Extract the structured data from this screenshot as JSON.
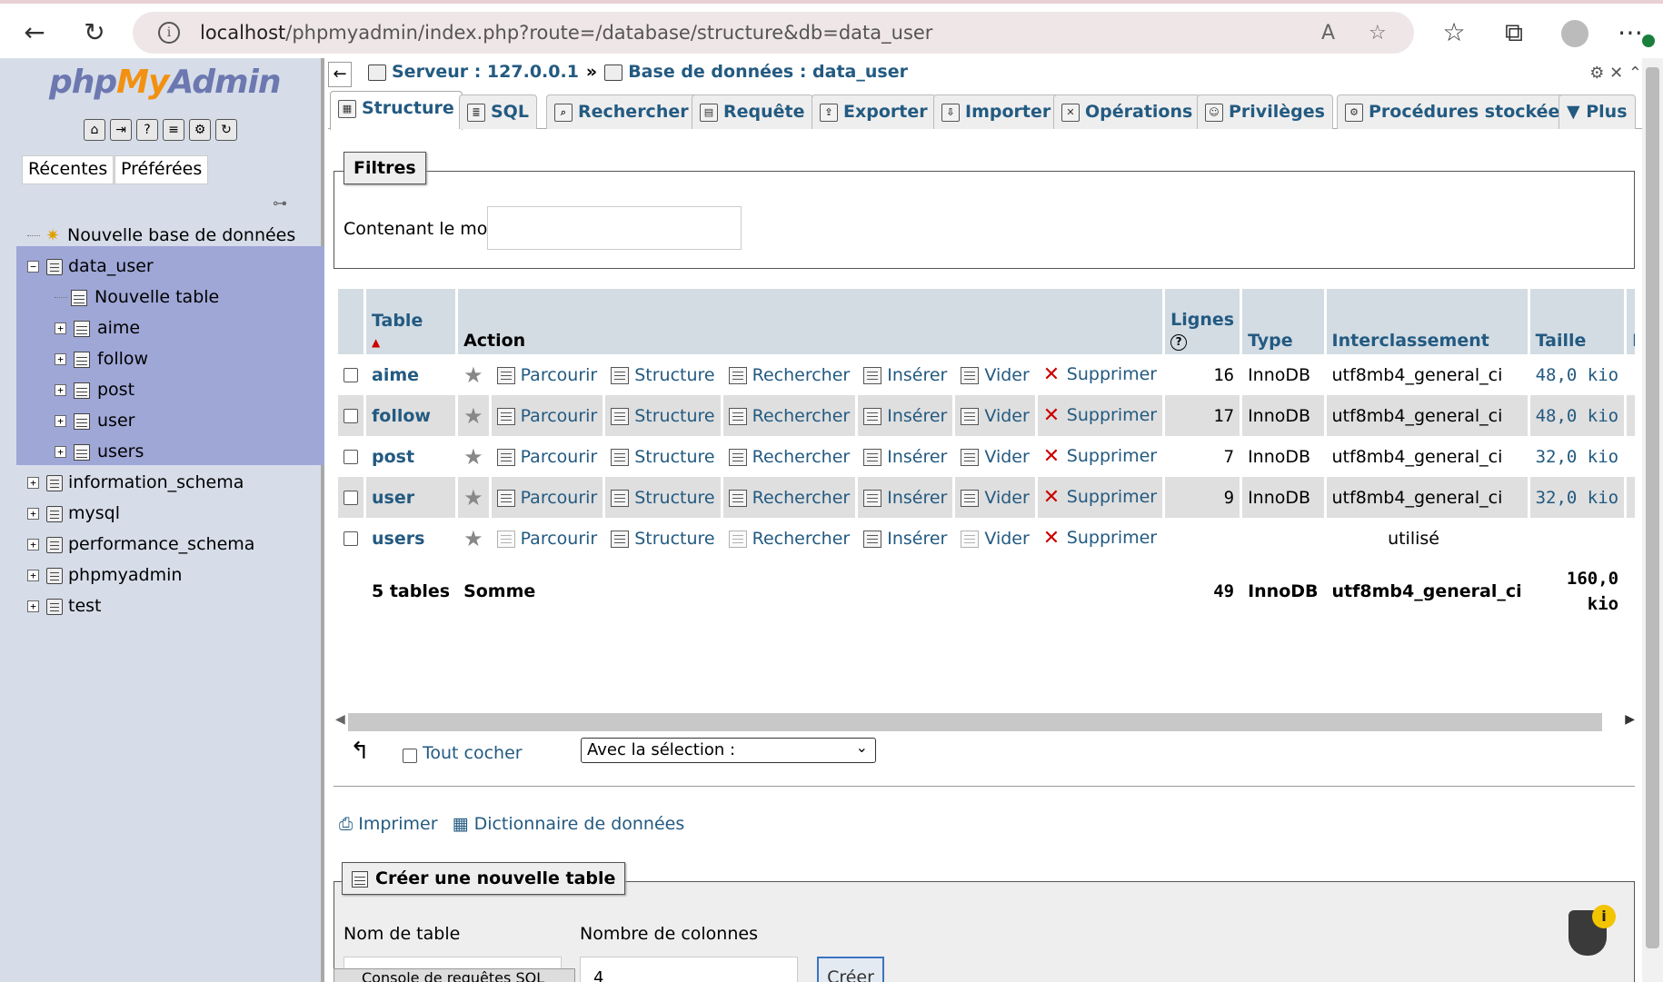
{
  "browser": {
    "url_host": "localhost",
    "url_path": "/phpmyadmin/index.php?route=/database/structure&db=data_user"
  },
  "left": {
    "logo_php": "php",
    "logo_my": "My",
    "logo_admin": "Admin",
    "tab_recent": "Récentes",
    "tab_fav": "Préférées",
    "new_db": "Nouvelle base de données",
    "db_active": "data_user",
    "new_table": "Nouvelle table",
    "active_tables": [
      "aime",
      "follow",
      "post",
      "user",
      "users"
    ],
    "other_dbs": [
      "information_schema",
      "mysql",
      "performance_schema",
      "phpmyadmin",
      "test"
    ]
  },
  "crumb": {
    "server": "Serveur : 127.0.0.1",
    "sep": "»",
    "db": "Base de données : data_user"
  },
  "tabs": [
    "Structure",
    "SQL",
    "Rechercher",
    "Requête",
    "Exporter",
    "Importer",
    "Opérations",
    "Privilèges",
    "Procédures stockées",
    "Plus"
  ],
  "filters": {
    "legend": "Filtres",
    "label": "Contenant le mot :"
  },
  "table": {
    "headers": {
      "table": "Table",
      "action": "Action",
      "rows": "Lignes",
      "type": "Type",
      "collation": "Interclassement",
      "size": "Taille",
      "overhead": "Pe"
    },
    "actions": [
      "Parcourir",
      "Structure",
      "Rechercher",
      "Insérer",
      "Vider",
      "Supprimer"
    ],
    "rows": [
      {
        "name": "aime",
        "rows": "16",
        "type": "InnoDB",
        "collation": "utf8mb4_general_ci",
        "size": "48,0 kio"
      },
      {
        "name": "follow",
        "rows": "17",
        "type": "InnoDB",
        "collation": "utf8mb4_general_ci",
        "size": "48,0 kio"
      },
      {
        "name": "post",
        "rows": "7",
        "type": "InnoDB",
        "collation": "utf8mb4_general_ci",
        "size": "32,0 kio"
      },
      {
        "name": "user",
        "rows": "9",
        "type": "InnoDB",
        "collation": "utf8mb4_general_ci",
        "size": "32,0 kio"
      },
      {
        "name": "users",
        "in_use": "utilisé"
      }
    ],
    "sum": {
      "label": "5 tables",
      "action": "Somme",
      "rows": "49",
      "type": "InnoDB",
      "collation": "utf8mb4_general_ci",
      "size_1": "160,0",
      "size_2": "kio",
      "overhead": "("
    }
  },
  "bulk": {
    "check_all": "Tout cocher",
    "with_selection": "Avec la sélection :"
  },
  "links": {
    "print": "Imprimer",
    "dictionary": "Dictionnaire de données"
  },
  "create": {
    "legend": "Créer une nouvelle table",
    "name_label": "Nom de table",
    "cols_label": "Nombre de colonnes",
    "cols_value": "4",
    "button": "Créer"
  },
  "console": {
    "label": "Console de requêtes SQL"
  }
}
